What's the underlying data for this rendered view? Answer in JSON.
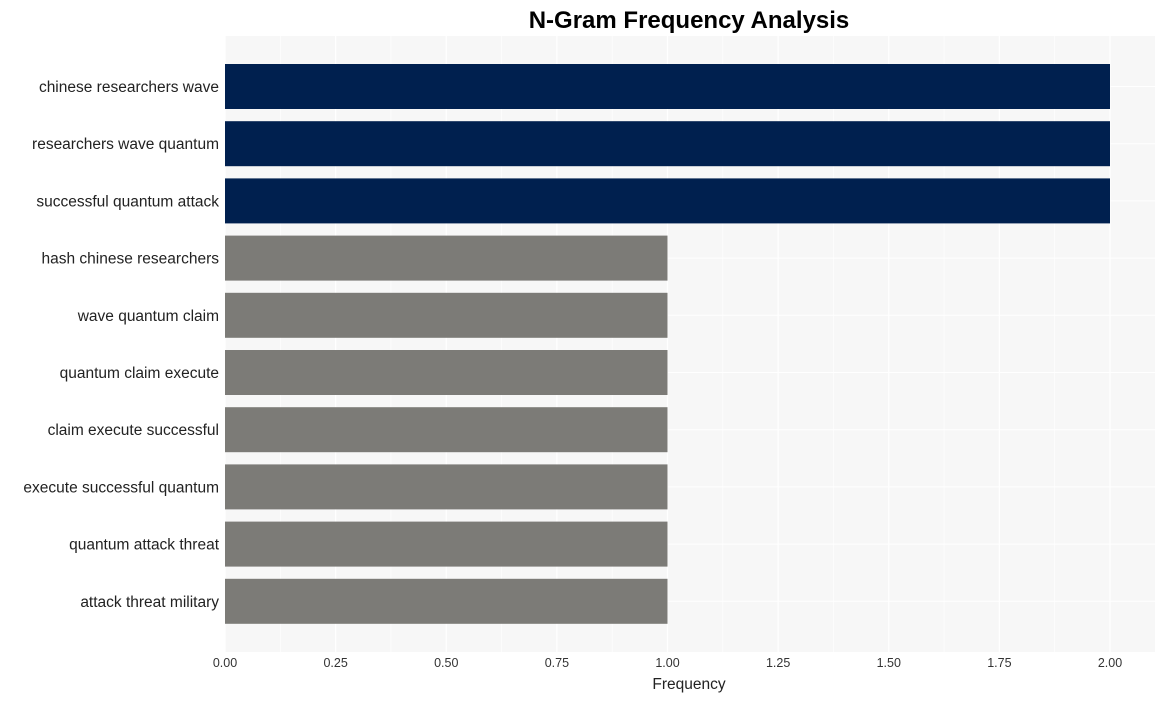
{
  "chart_data": {
    "type": "bar",
    "orientation": "horizontal",
    "title": "N-Gram Frequency Analysis",
    "xlabel": "Frequency",
    "ylabel": "",
    "xlim": [
      0,
      2.1
    ],
    "xticks": [
      "0.00",
      "0.25",
      "0.50",
      "0.75",
      "1.00",
      "1.25",
      "1.50",
      "1.75",
      "2.00"
    ],
    "xtick_values": [
      0,
      0.25,
      0.5,
      0.75,
      1.0,
      1.25,
      1.5,
      1.75,
      2.0
    ],
    "grid": true,
    "categories": [
      "chinese researchers wave",
      "researchers wave quantum",
      "successful quantum attack",
      "hash chinese researchers",
      "wave quantum claim",
      "quantum claim execute",
      "claim execute successful",
      "execute successful quantum",
      "quantum attack threat",
      "attack threat military"
    ],
    "values": [
      2,
      2,
      2,
      1,
      1,
      1,
      1,
      1,
      1,
      1
    ],
    "colors": {
      "highlight": "#00204f",
      "default": "#7c7b77",
      "plot_background": "#f7f7f7",
      "grid": "#ffffff"
    }
  }
}
